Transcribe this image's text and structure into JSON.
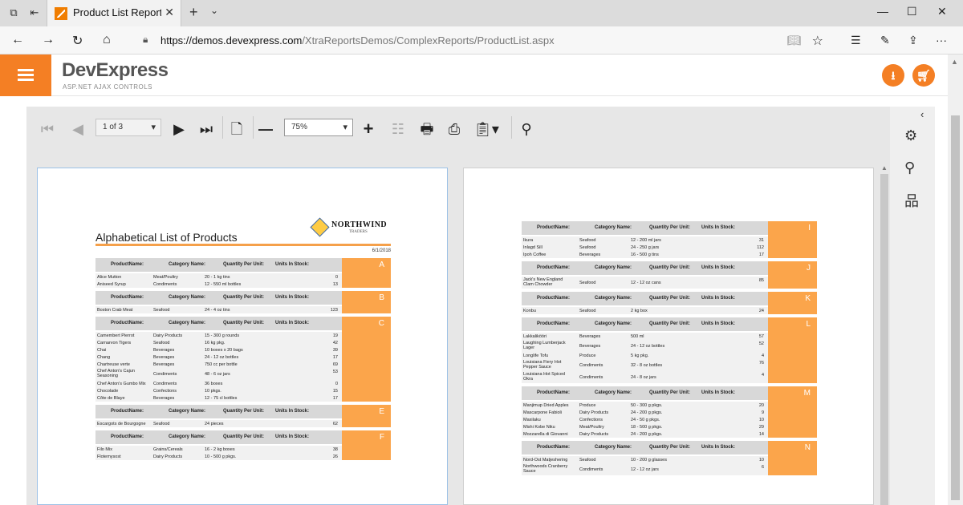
{
  "browser": {
    "tab_title": "Product List Report - Re",
    "url_host": "https://demos.devexpress.com",
    "url_path": "/XtraReportsDemos/ComplexReports/ProductList.aspx"
  },
  "site": {
    "brand": "DevExpress",
    "brand_sub": "ASP.NET AJAX CONTROLS"
  },
  "viewer": {
    "page_selector": "1 of 3",
    "zoom": "75%"
  },
  "report": {
    "title": "Alphabetical List of Products",
    "logo_text": "NORTHWIND",
    "logo_sub": "TRADERS",
    "date": "6/1/2018",
    "columns": [
      "ProductName:",
      "Category Name:",
      "Quantity Per Unit:",
      "Units In Stock:"
    ],
    "page1_groups": [
      {
        "letter": "A",
        "rows": [
          [
            "Alice Mutton",
            "Meat/Poultry",
            "20 - 1 kg tins",
            "0"
          ],
          [
            "Aniseed Syrup",
            "Condiments",
            "12 - 550 ml bottles",
            "13"
          ]
        ]
      },
      {
        "letter": "B",
        "rows": [
          [
            "Boston Crab Meat",
            "Seafood",
            "24 - 4 oz tins",
            "123"
          ]
        ]
      },
      {
        "letter": "C",
        "rows": [
          [
            "Camembert Pierrot",
            "Dairy Products",
            "15 - 300 g rounds",
            "19"
          ],
          [
            "Carnarvon Tigers",
            "Seafood",
            "16 kg pkg.",
            "42"
          ],
          [
            "Chai",
            "Beverages",
            "10 boxes x 20 bags",
            "39"
          ],
          [
            "Chang",
            "Beverages",
            "24 - 12 oz bottles",
            "17"
          ],
          [
            "Chartreuse verte",
            "Beverages",
            "750 cc per bottle",
            "69"
          ],
          [
            "Chef Anton's Cajun Seasoning",
            "Condiments",
            "48 - 6 oz jars",
            "53"
          ],
          [
            "Chef Anton's Gumbo Mix",
            "Condiments",
            "36 boxes",
            "0"
          ],
          [
            "Chocolade",
            "Confections",
            "10 pkgs.",
            "15"
          ],
          [
            "Côte de Blaye",
            "Beverages",
            "12 - 75 cl bottles",
            "17"
          ]
        ]
      },
      {
        "letter": "E",
        "rows": [
          [
            "Escargots de Bourgogne",
            "Seafood",
            "24 pieces",
            "62"
          ]
        ]
      },
      {
        "letter": "F",
        "rows": [
          [
            "Filo Mix",
            "Grains/Cereals",
            "16 - 2 kg boxes",
            "38"
          ],
          [
            "Flotemysost",
            "Dairy Products",
            "10 - 500 g pkgs.",
            "26"
          ]
        ]
      }
    ],
    "page2_groups": [
      {
        "letter": "I",
        "rows": [
          [
            "Ikura",
            "Seafood",
            "12 - 200 ml jars",
            "31"
          ],
          [
            "Inlagd Sill",
            "Seafood",
            "24 - 250 g  jars",
            "112"
          ],
          [
            "Ipoh Coffee",
            "Beverages",
            "16 - 500 g tins",
            "17"
          ]
        ]
      },
      {
        "letter": "J",
        "rows": [
          [
            "Jack's New England Clam Chowder",
            "Seafood",
            "12 - 12 oz cans",
            "85"
          ]
        ]
      },
      {
        "letter": "K",
        "rows": [
          [
            "Konbu",
            "Seafood",
            "2 kg box",
            "24"
          ]
        ]
      },
      {
        "letter": "L",
        "rows": [
          [
            "Lakkalikööri",
            "Beverages",
            "500 ml",
            "57"
          ],
          [
            "Laughing Lumberjack Lager",
            "Beverages",
            "24 - 12 oz bottles",
            "52"
          ],
          [
            "Longlife Tofu",
            "Produce",
            "5 kg pkg.",
            "4"
          ],
          [
            "Louisiana Fiery Hot Pepper Sauce",
            "Condiments",
            "32 - 8 oz bottles",
            "76"
          ],
          [
            "Louisiana Hot Spiced Okra",
            "Condiments",
            "24 - 8 oz jars",
            "4"
          ]
        ]
      },
      {
        "letter": "M",
        "rows": [
          [
            "Manjimup Dried Apples",
            "Produce",
            "50 - 300 g pkgs.",
            "20"
          ],
          [
            "Mascarpone Fabioli",
            "Dairy Products",
            "24 - 200 g pkgs.",
            "9"
          ],
          [
            "Maxilaku",
            "Confections",
            "24 - 50 g pkgs.",
            "10"
          ],
          [
            "Mishi Kobe Niku",
            "Meat/Poultry",
            "18 - 500 g pkgs.",
            "29"
          ],
          [
            "Mozzarella di Giovanni",
            "Dairy Products",
            "24 - 200 g pkgs.",
            "14"
          ]
        ]
      },
      {
        "letter": "N",
        "rows": [
          [
            "Nord-Ost Matjeshering",
            "Seafood",
            "10 - 200 g glasses",
            "10"
          ],
          [
            "Northwoods Cranberry Sauce",
            "Condiments",
            "12 - 12 oz jars",
            "6"
          ]
        ]
      }
    ]
  }
}
